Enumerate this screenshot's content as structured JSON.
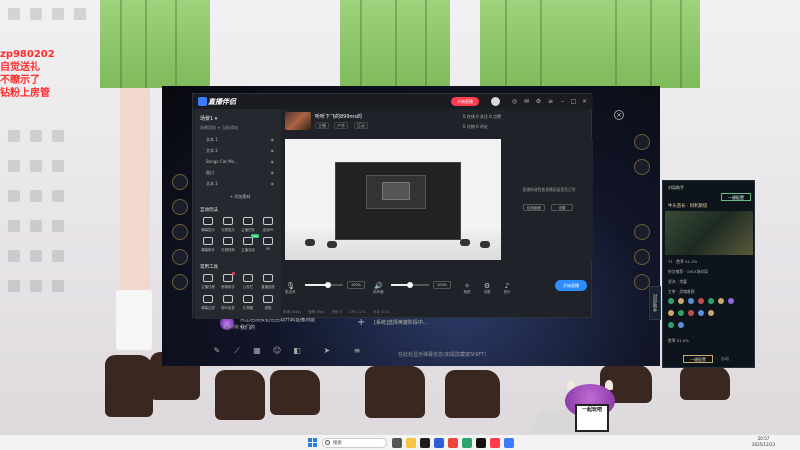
{
  "overlay": {
    "lines": [
      "zp980202",
      "自觉送礼",
      "不瞭示了",
      "钻粉上房管"
    ]
  },
  "app": {
    "name": "直播伴侣",
    "live_button": "开始直播",
    "scene_title": "场景1 ▾",
    "scene_sub": "场景添加 ≡ 当前添加",
    "sources": [
      {
        "label": "文本 1"
      },
      {
        "label": "文本 2"
      },
      {
        "label": "Bongo Cat Mo..."
      },
      {
        "label": "窗口"
      },
      {
        "label": "文本 1"
      }
    ],
    "add_source": "+ 添加素材",
    "section_interact": "互动玩法",
    "section_tools": "常用工具",
    "interact_items": [
      "弹幕显示",
      "礼物显示",
      "主播任务",
      "连线PK",
      "弹幕助手",
      "礼物特效",
      "主播互动",
      "PK"
    ],
    "tool_items": [
      "主播日程",
      "房管助手",
      "公告栏",
      "直播回放",
      "弹幕过滤",
      "观众信息",
      "礼物箱",
      "成就"
    ],
    "more": "更多功能 ▾",
    "room_title": "听听下飞的899ms的",
    "room_tags": [
      "主播",
      "户外",
      "互动"
    ],
    "room_stats": "0 在线 0 关注 0 点赞",
    "room_stats2": "0 礼物 0 评论",
    "side_panel_text": "直播前请检查直播画面是否正常",
    "side_btn_left": "检测画面",
    "side_btn_right": "设置",
    "controls": {
      "mic_label": "麦克风",
      "mic_pct": "100%",
      "speaker_label": "扬声器",
      "speaker_pct": "100%",
      "mic_level": 0.6,
      "speaker_level": 0.5,
      "items": [
        "美颜",
        "设置",
        "音乐"
      ],
      "start": "开始直播"
    },
    "status": [
      "码率 0kb/s",
      "帧率 0fps",
      "丢帧 0",
      "CPU 12%",
      "内存 40%"
    ]
  },
  "game": {
    "chat_line1": "点击右侧按钮在自动开启直播功能",
    "chat_line2": "我们的",
    "chat_sys": "[系统]选择英雄阶段中...",
    "shortcut_hint": "在此处显示弹幕信息(如需隐藏按SHIFT)"
  },
  "lol_panel": {
    "tab1": "对局助手",
    "tab2": "一键配置",
    "champ": "牛头酋长 · 阿利斯塔",
    "line1": "T1 · 胜率 51.2%",
    "line2": "符文推荐 · 1913场对局",
    "line3": "坚决 · 余震",
    "line4": "主宰 · 灵魂收割",
    "line5": "胜率 51.0%",
    "choose": "一键配置",
    "auto": "自动",
    "side_tab": "对局助手"
  },
  "taskbar": {
    "search": "搜索",
    "time": "20:57",
    "date": "2025/12/23"
  },
  "mascot": {
    "sign": "一起玩吧"
  }
}
